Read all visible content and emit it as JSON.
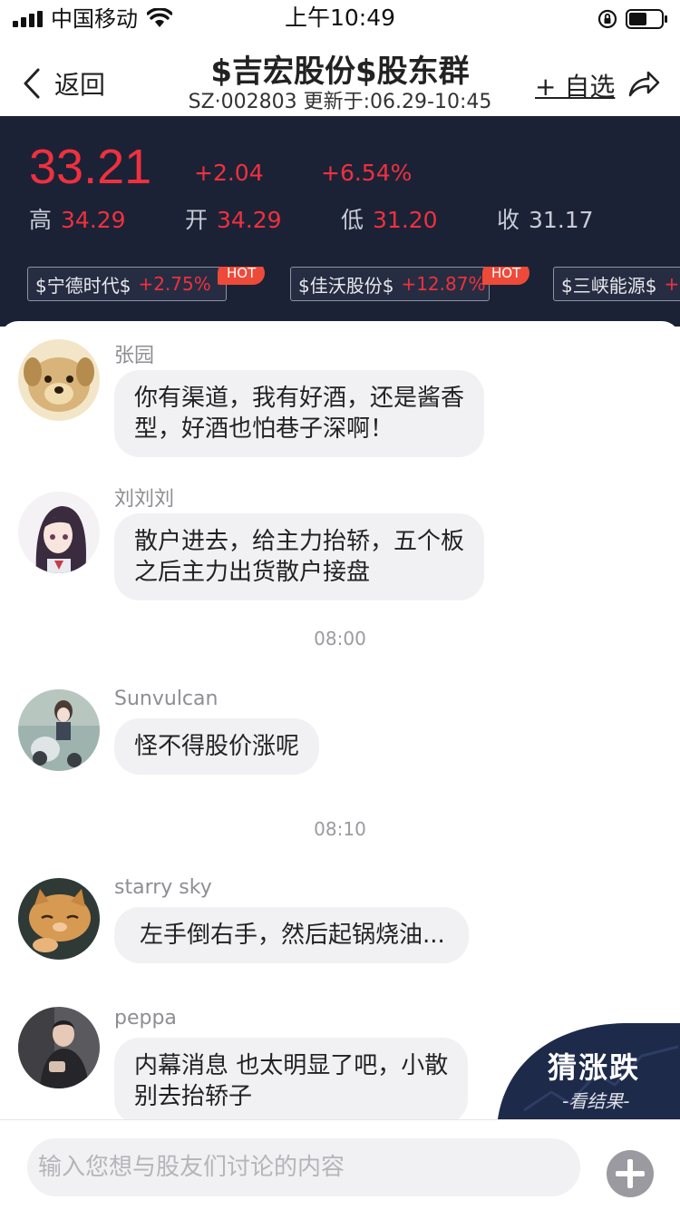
{
  "status": {
    "carrier": "中国移动",
    "time": "上午10:49"
  },
  "nav": {
    "back_label": "返回",
    "title": "$吉宏股份$股东群",
    "subtitle": "SZ·002803 更新于:06.29-10:45",
    "add_fav_label": "+ 自选"
  },
  "stock": {
    "price": "33.21",
    "change": "+2.04",
    "change_pct": "+6.54%",
    "stats": [
      {
        "label": "高",
        "value": "34.29"
      },
      {
        "label": "开",
        "value": "34.29"
      },
      {
        "label": "低",
        "value": "31.20"
      },
      {
        "label": "收",
        "value": "31.17"
      }
    ],
    "tags": [
      {
        "name": "$宁德时代$",
        "pct": "+2.75%",
        "badge": "HOT"
      },
      {
        "name": "$佳沃股份$",
        "pct": "+12.87%",
        "badge": "HOT"
      },
      {
        "name": "$三峡能源$",
        "pct": "+"
      }
    ],
    "colors": {
      "up": "#f0303e",
      "panel_bg": "#1b2236"
    }
  },
  "messages": [
    {
      "user": "张园",
      "text_lines": [
        "你有渠道，我有好酒，还是酱香",
        "型，好酒也怕巷子深啊！"
      ],
      "avatar": "puppy-avatar"
    },
    {
      "user": "刘刘刘",
      "text_lines": [
        "散户进去，给主力抬轿，五个板",
        "之后主力出货散户接盘"
      ],
      "avatar": "anime-girl-avatar"
    },
    {
      "time": "08:00"
    },
    {
      "user": "Sunvulcan",
      "text_lines": [
        "怪不得股价涨呢"
      ],
      "avatar": "anime-scooter-avatar"
    },
    {
      "time": "08:10"
    },
    {
      "user": "starry sky",
      "text_lines": [
        "左手倒右手，然后起锅烧油..."
      ],
      "avatar": "cat-avatar"
    },
    {
      "user": "peppa",
      "text_lines": [
        "内幕消息 也太明显了吧，小散",
        "别去抬轿子"
      ],
      "avatar": "man-avatar"
    }
  ],
  "guess_badge": {
    "title": "猜涨跌",
    "subtitle": "-看结果-"
  },
  "input": {
    "placeholder": "输入您想与股友们讨论的内容",
    "value": ""
  }
}
